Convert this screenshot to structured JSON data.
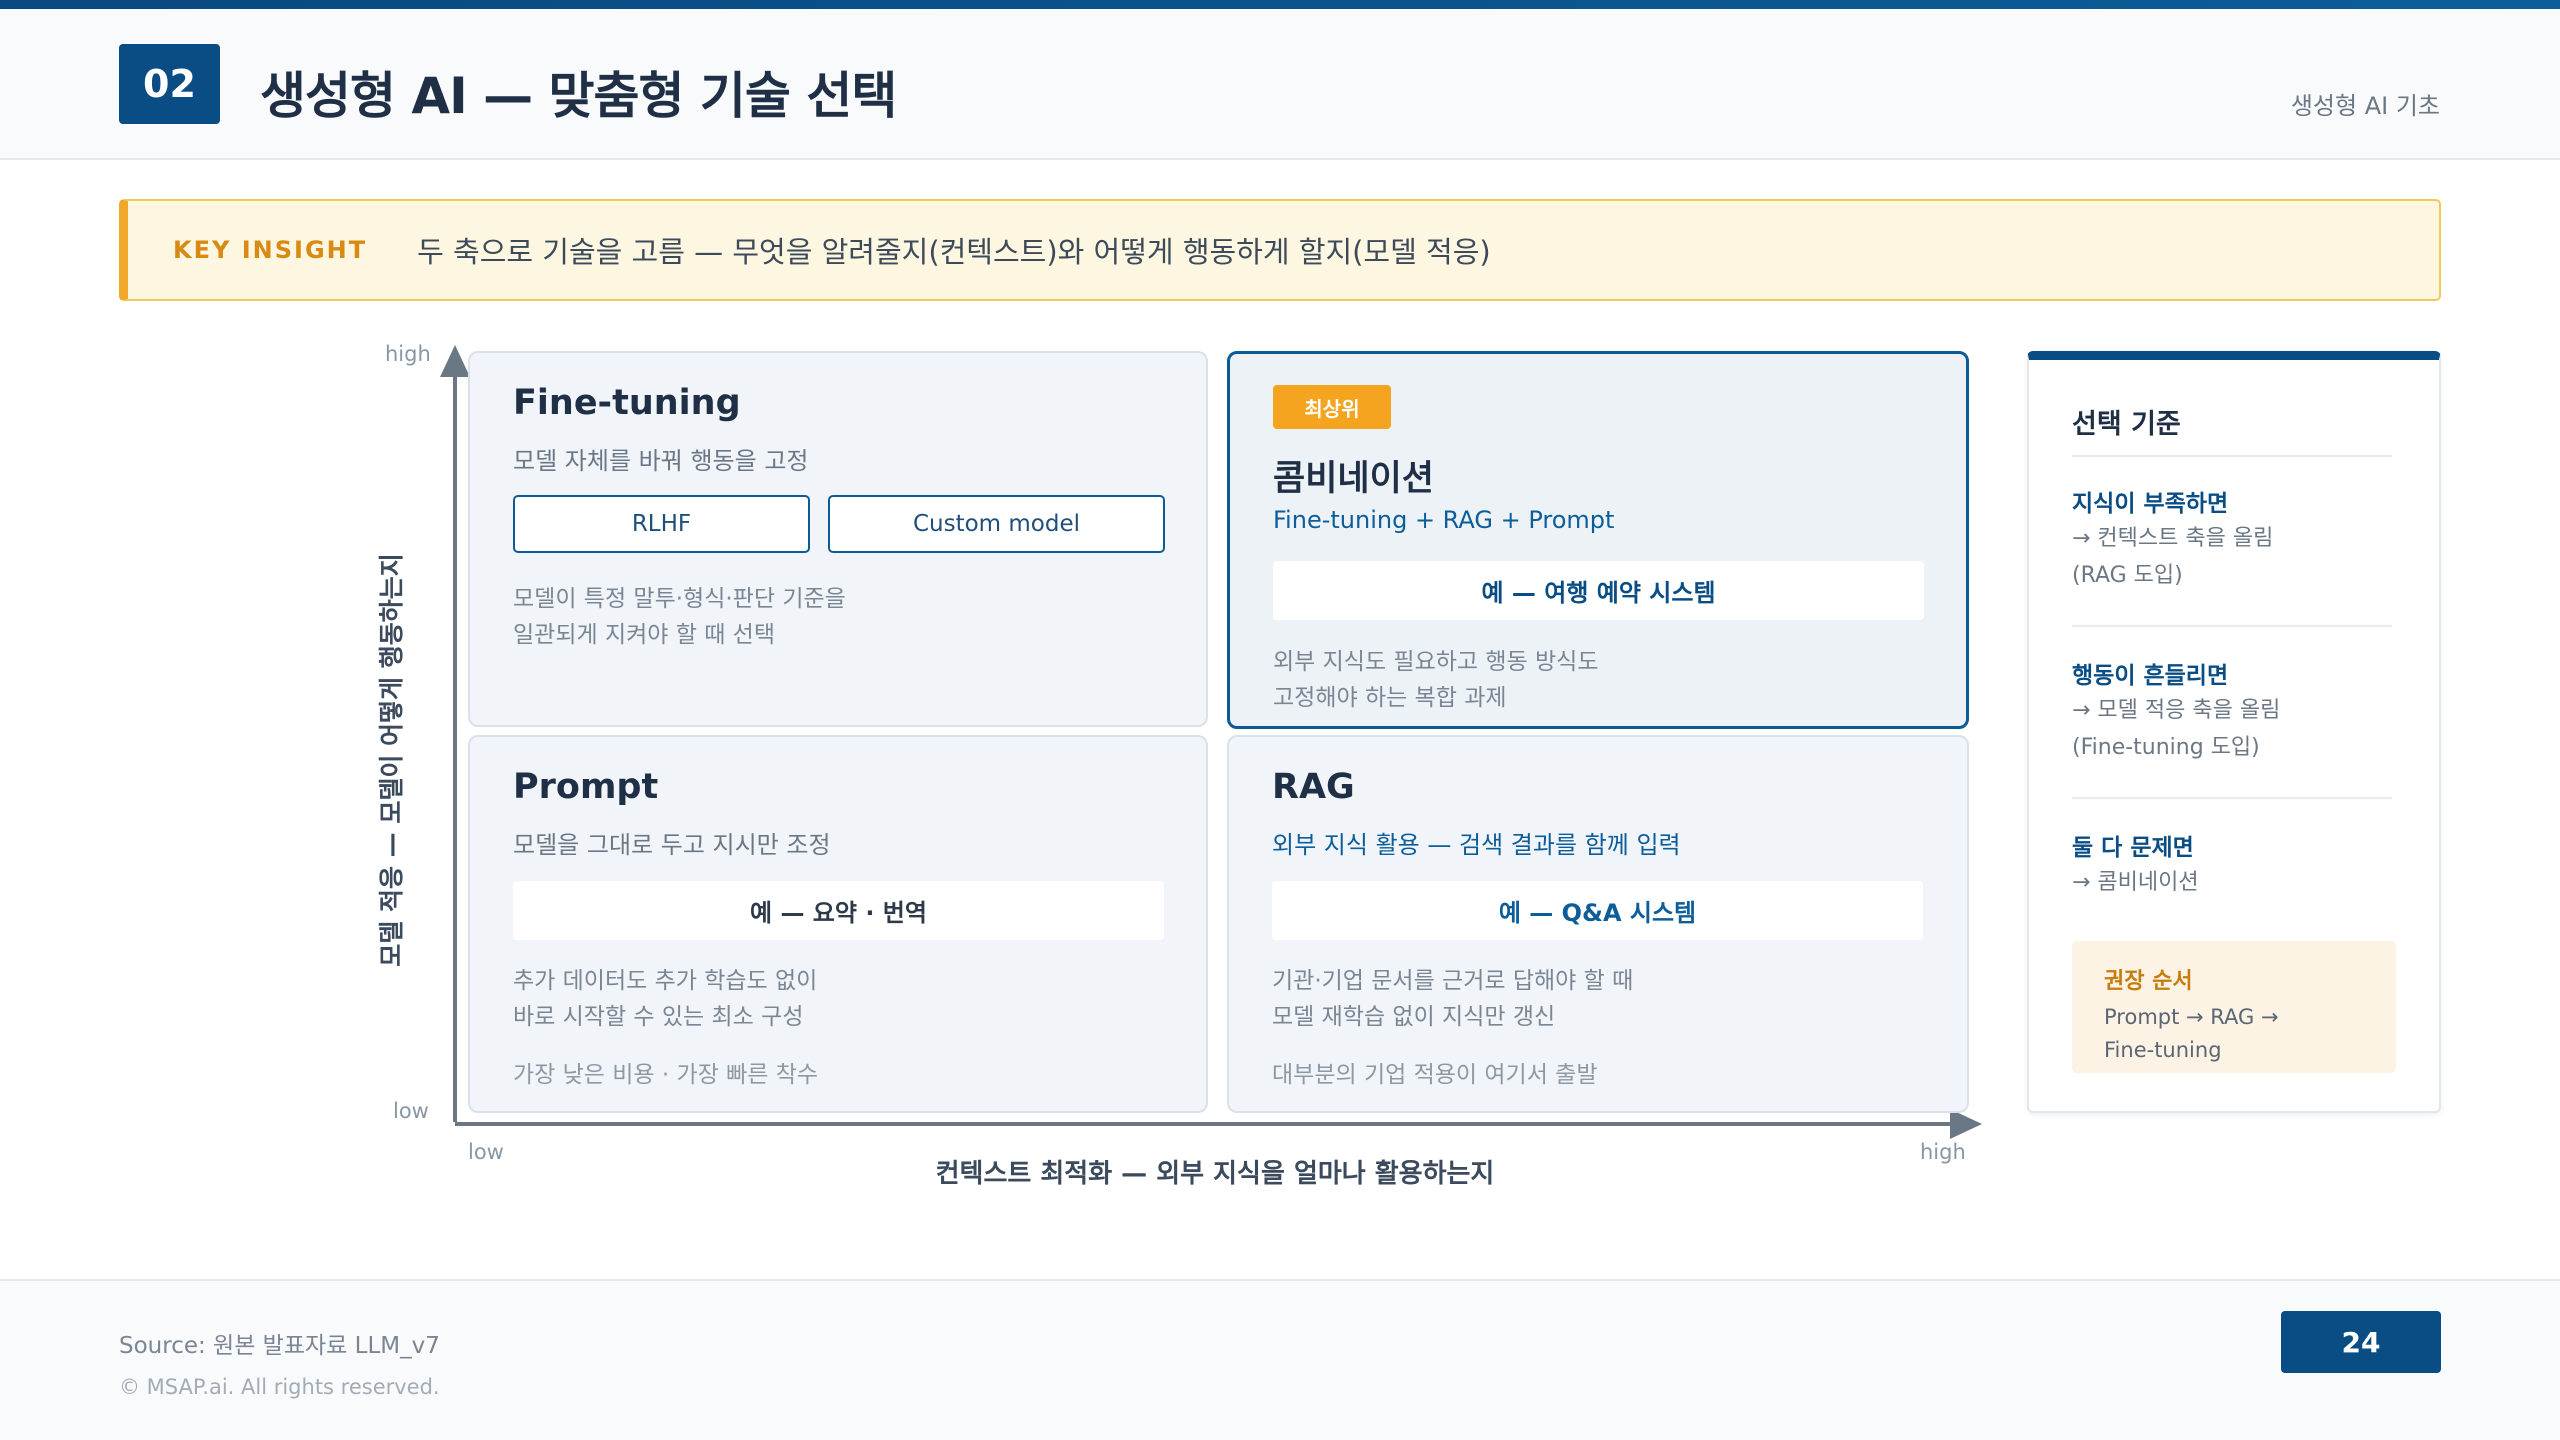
{
  "header": {
    "section_number": "02",
    "title": "생성형 AI — 맞춤형 기술 선택",
    "course": "생성형 AI 기초"
  },
  "insight": {
    "tag": "KEY INSIGHT",
    "text": "두 축으로 기술을 고름 — 무엇을 알려줄지(컨텍스트)와 어떻게 행동하게 할지(모델 적응)"
  },
  "axes": {
    "y_high": "high",
    "y_low": "low",
    "y_label": "모델 적응 — 모델이 어떻게 행동하는지",
    "x_low": "low",
    "x_high": "high",
    "x_label": "컨텍스트 최적화 — 외부 지식을 얼마나 활용하는지"
  },
  "quadrants": {
    "finetuning": {
      "title": "Fine-tuning",
      "subtitle": "모델 자체를 바꿔 행동을 고정",
      "tags": [
        "RLHF",
        "Custom model"
      ],
      "desc_line1": "모델이 특정 말투·형식·판단 기준을",
      "desc_line2": "일관되게 지켜야 할 때 선택"
    },
    "combination": {
      "badge": "최상위",
      "title": "콤비네이션",
      "subtitle": "Fine-tuning + RAG + Prompt",
      "example": "예 — 여행 예약 시스템",
      "desc_line1": "외부 지식도 필요하고 행동 방식도",
      "desc_line2": "고정해야 하는 복합 과제"
    },
    "prompt": {
      "title": "Prompt",
      "subtitle": "모델을 그대로 두고 지시만 조정",
      "example": "예 — 요약 · 번역",
      "desc_line1": "추가 데이터도 추가 학습도 없이",
      "desc_line2": "바로 시작할 수 있는 최소 구성",
      "note": "가장 낮은 비용 · 가장 빠른 착수"
    },
    "rag": {
      "title": "RAG",
      "subtitle": "외부 지식 활용 — 검색 결과를 함께 입력",
      "example": "예 — Q&A 시스템",
      "desc_line1": "기관·기업 문서를 근거로 답해야 할 때",
      "desc_line2": "모델 재학습 없이 지식만 갱신",
      "note": "대부분의 기업 적용이 여기서 출발"
    }
  },
  "criteria": {
    "title": "선택 기준",
    "items": [
      {
        "heading": "지식이 부족하면",
        "line1": "→ 컨텍스트 축을 올림",
        "line2": "(RAG 도입)"
      },
      {
        "heading": "행동이 흔들리면",
        "line1": "→ 모델 적응 축을 올림",
        "line2": "(Fine-tuning 도입)"
      },
      {
        "heading": "둘 다 문제면",
        "line1": "→ 콤비네이션",
        "line2": ""
      }
    ],
    "recommend": {
      "heading": "권장 순서",
      "line1": "Prompt → RAG →",
      "line2": "Fine-tuning"
    }
  },
  "footer": {
    "source": "Source: 원본 발표자료 LLM_v7",
    "copyright": "© MSAP.ai. All rights reserved.",
    "page": "24"
  },
  "colors": {
    "primary": "#0a4d85",
    "accent": "#f4a41f",
    "insight_bg": "#fdf6e1"
  }
}
